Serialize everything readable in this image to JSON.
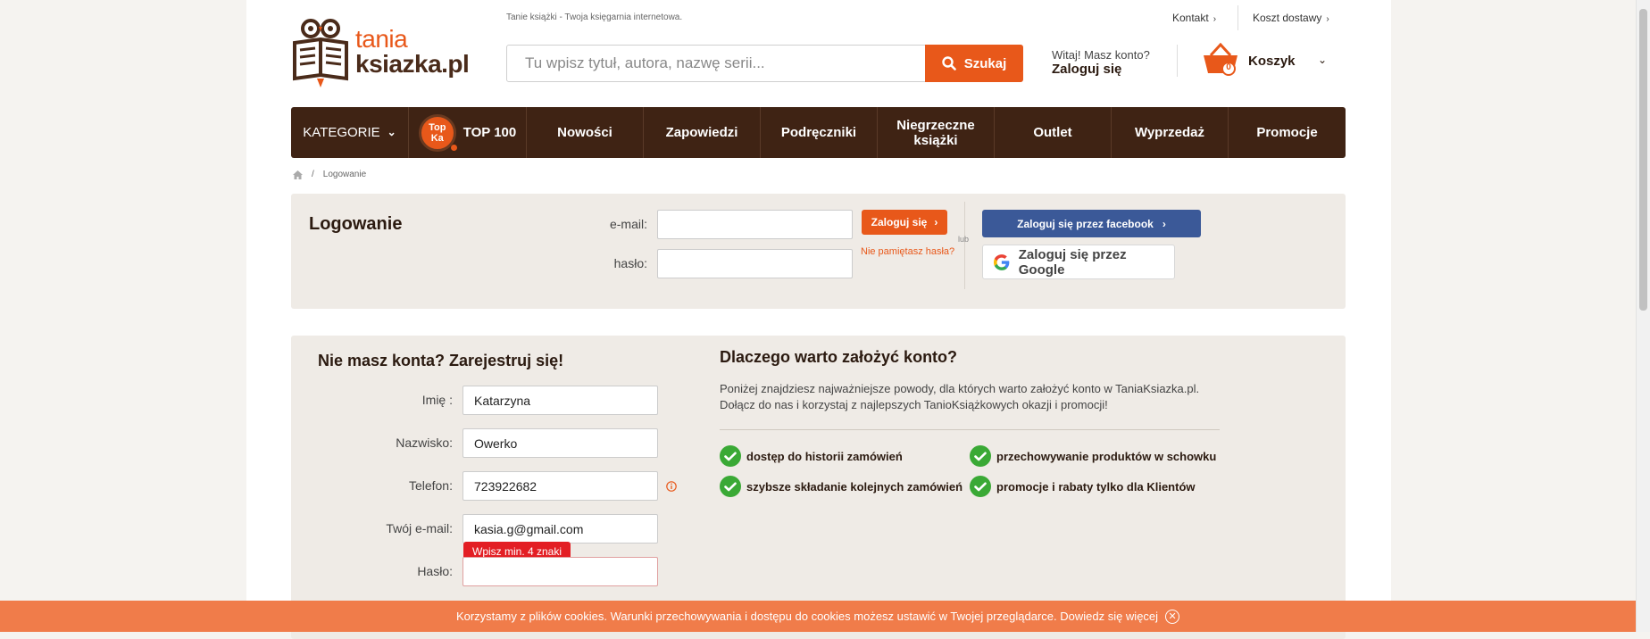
{
  "header": {
    "logo_line1": "tania",
    "logo_line2": "ksiazka.pl",
    "tagline": "Tanie książki - Twoja księgarnia internetowa.",
    "top_links": [
      "Kontakt",
      "Koszt dostawy"
    ],
    "search_placeholder": "Tu wpisz tytuł, autora, nazwę serii...",
    "search_button": "Szukaj",
    "welcome_text": "Witaj! Masz konto?",
    "login_link": "Zaloguj się",
    "cart_label": "Koszyk",
    "cart_count": "0"
  },
  "menu": {
    "categories": "KATEGORIE",
    "top_badge_line1": "Top",
    "top_badge_line2": "Ka",
    "top100": "TOP 100",
    "items": [
      "Nowości",
      "Zapowiedzi",
      "Podręczniki",
      "Niegrzeczne książki",
      "Outlet",
      "Wyprzedaż",
      "Promocje"
    ]
  },
  "breadcrumb": {
    "separator": "/",
    "current": "Logowanie"
  },
  "login": {
    "title": "Logowanie",
    "email_label": "e-mail:",
    "password_label": "hasło:",
    "email_value": "",
    "password_value": "",
    "submit_label": "Zaloguj się",
    "forgot_label": "Nie pamiętasz hasła?",
    "or_label": "lub",
    "facebook_label": "Zaloguj się przez facebook",
    "google_label": "Zaloguj się przez Google"
  },
  "register": {
    "title": "Nie masz konta? Zarejestruj się!",
    "fields": [
      {
        "label": "Imię :",
        "value": "Katarzyna"
      },
      {
        "label": "Nazwisko:",
        "value": "Owerko"
      },
      {
        "label": "Telefon:",
        "value": "723922682"
      },
      {
        "label": "Twój e-mail:",
        "value": "kasia.g@gmail.com"
      },
      {
        "label": "Hasło:",
        "value": ""
      }
    ],
    "error_message": "Wpisz min. 4 znaki"
  },
  "why": {
    "title": "Dlaczego warto założyć konto?",
    "text": "Poniżej znajdziesz najważniejsze powody, dla których warto założyć konto w TaniaKsiazka.pl. Dołącz do nas i korzystaj z najlepszych TanioKsiążkowych okazji i promocji!",
    "benefits": [
      "dostęp do historii zamówień",
      "przechowywanie produktów w schowku",
      "szybsze składanie kolejnych zamówień",
      "promocje i rabaty tylko dla Klientów"
    ]
  },
  "cookie_bar": {
    "text": "Korzystamy z plików cookies. Warunki przechowywania i dostępu do cookies możesz ustawić w Twojej przeglądarce. Dowiedz się więcej"
  },
  "colors": {
    "accent": "#e8581a",
    "menu_bg": "#3f2314",
    "facebook": "#3b5998",
    "success": "#3aa935",
    "error": "#e31e24",
    "cookie_bg": "#f07c4a"
  },
  "icons": [
    "owl-book-logo",
    "search-icon",
    "cart-icon",
    "chevron-down-icon",
    "home-icon",
    "chevron-right-icon",
    "google-icon",
    "check-icon",
    "info-icon",
    "close-icon"
  ]
}
